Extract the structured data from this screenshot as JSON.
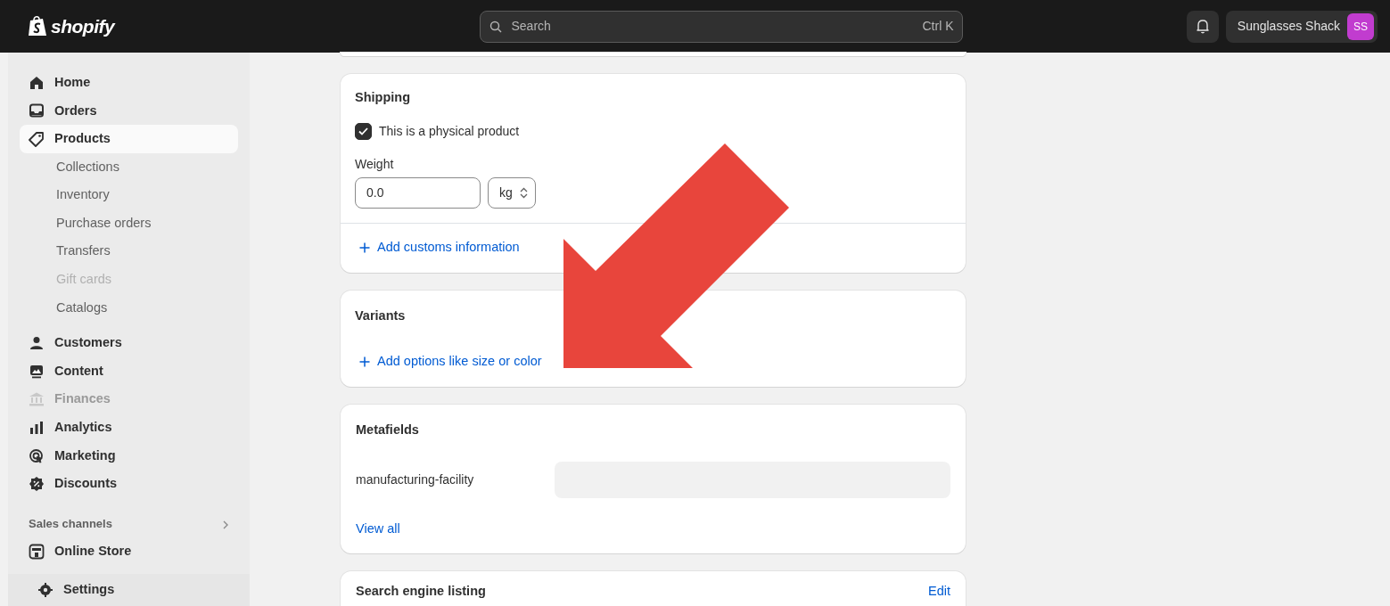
{
  "topbar": {
    "logo": "shopify",
    "search": {
      "placeholder": "Search",
      "shortcut": "Ctrl K"
    },
    "store": {
      "name": "Sunglasses Shack",
      "initials": "SS"
    }
  },
  "sidebar": {
    "items": [
      {
        "label": "Home",
        "selected": false,
        "disabled": false
      },
      {
        "label": "Orders",
        "selected": false,
        "disabled": false
      },
      {
        "label": "Products",
        "selected": true,
        "disabled": false,
        "children": [
          {
            "label": "Collections",
            "disabled": false
          },
          {
            "label": "Inventory",
            "disabled": false
          },
          {
            "label": "Purchase orders",
            "disabled": false
          },
          {
            "label": "Transfers",
            "disabled": false
          },
          {
            "label": "Gift cards",
            "disabled": true
          },
          {
            "label": "Catalogs",
            "disabled": false
          }
        ]
      },
      {
        "label": "Customers",
        "selected": false,
        "disabled": false
      },
      {
        "label": "Content",
        "selected": false,
        "disabled": false
      },
      {
        "label": "Finances",
        "selected": false,
        "disabled": true
      },
      {
        "label": "Analytics",
        "selected": false,
        "disabled": false
      },
      {
        "label": "Marketing",
        "selected": false,
        "disabled": false
      },
      {
        "label": "Discounts",
        "selected": false,
        "disabled": false
      }
    ],
    "sales_channels": {
      "label": "Sales channels",
      "items": [
        {
          "label": "Online Store",
          "selected": false
        }
      ]
    },
    "settings": "Settings"
  },
  "shipping": {
    "title": "Shipping",
    "physical": {
      "label": "This is a physical product",
      "checked": true
    },
    "weight_label": "Weight",
    "weight": "0.0",
    "unit": "kg",
    "customs_link": "Add customs information"
  },
  "variants": {
    "title": "Variants",
    "add_link": "Add options like size or color"
  },
  "metafields": {
    "title": "Metafields",
    "fields": [
      {
        "name": "manufacturing-facility"
      }
    ],
    "view_all": "View all"
  },
  "seo": {
    "title": "Search engine listing",
    "edit": "Edit"
  }
}
